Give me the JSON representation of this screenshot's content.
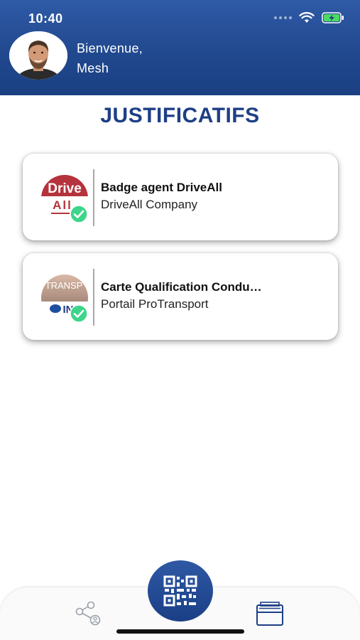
{
  "status_bar": {
    "time": "10:40"
  },
  "header": {
    "greeting_line1": "Bienvenue,",
    "greeting_line2": "Mesh"
  },
  "page": {
    "title": "JUSTIFICATIFS"
  },
  "cards": [
    {
      "title": "Badge agent DriveAll",
      "subtitle": "DriveAll Company",
      "logo_text_top": "Drive",
      "logo_text_bottom": "All",
      "verified": true
    },
    {
      "title": "Carte Qualification Condu…",
      "subtitle": "Portail ProTransport",
      "logo_text_top": "TRANSP",
      "logo_text_bottom": "IN",
      "verified": true
    }
  ],
  "icons": {
    "wifi": "wifi-icon",
    "battery": "battery-charging-icon",
    "verified": "check-circle-icon",
    "share": "share-icon",
    "qr": "qr-code-icon",
    "wallet": "wallet-icon"
  },
  "colors": {
    "brand_blue": "#1d3f86",
    "header_blue": "#2f5aa6",
    "verified_green": "#3ed58a",
    "driveall_red": "#b5333c"
  }
}
